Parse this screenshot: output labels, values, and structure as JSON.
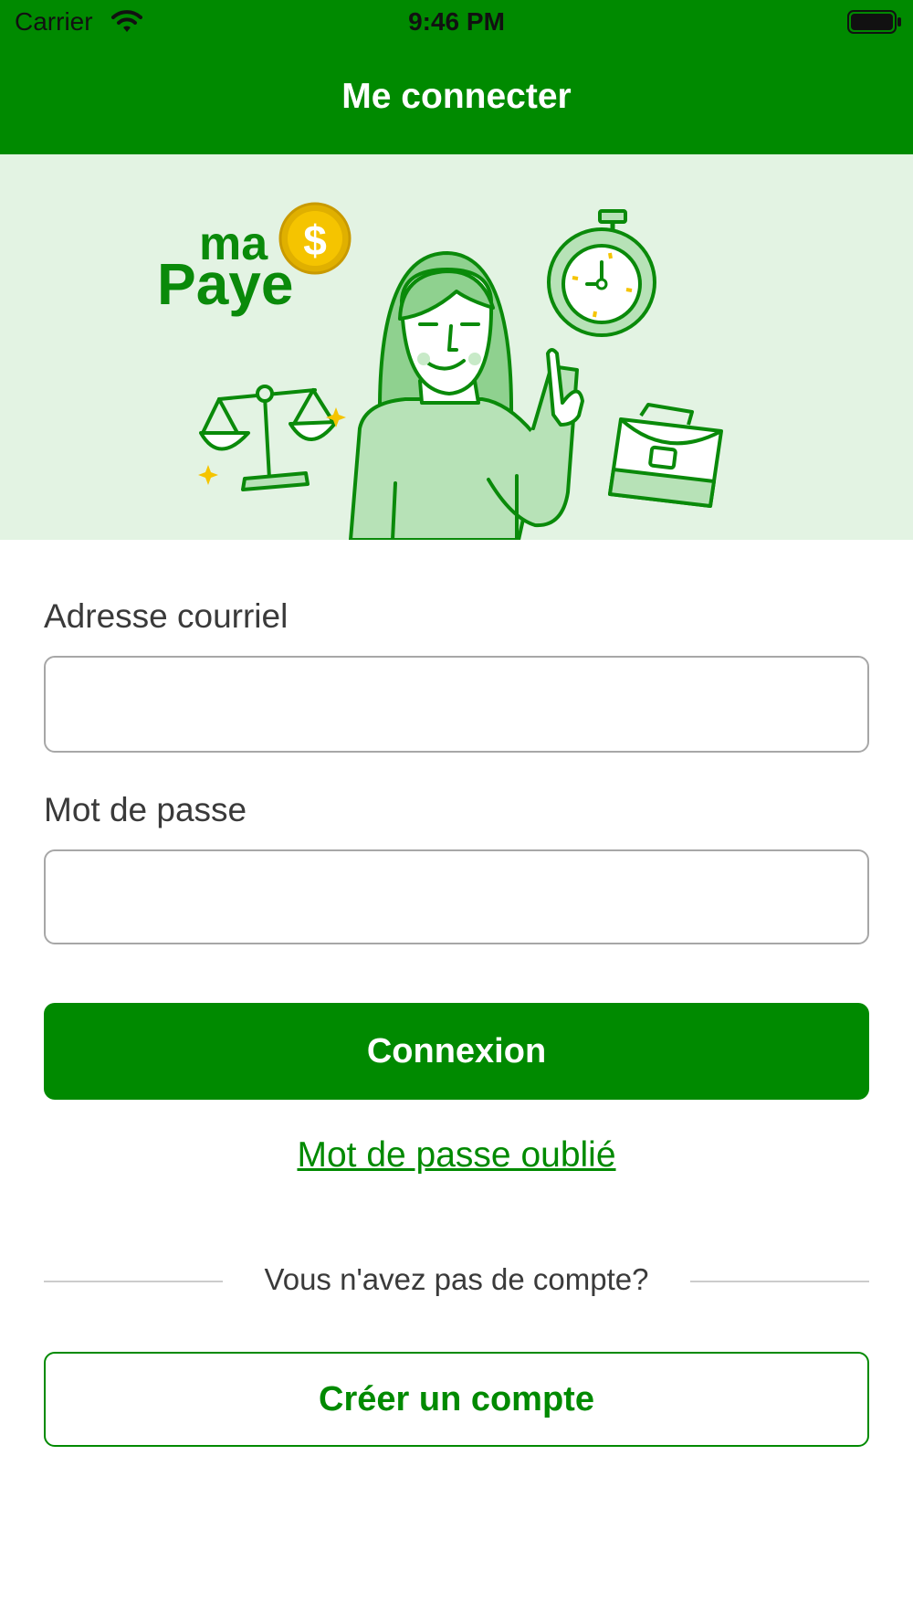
{
  "status_bar": {
    "carrier": "Carrier",
    "time": "9:46 PM"
  },
  "header": {
    "title": "Me connecter"
  },
  "hero": {
    "logo_line1": "ma",
    "logo_line2": "Paye",
    "coin_symbol": "$"
  },
  "form": {
    "email_label": "Adresse courriel",
    "email_value": "",
    "password_label": "Mot de passe",
    "password_value": "",
    "login_button": "Connexion",
    "forgot_link": "Mot de passe oublié"
  },
  "signup": {
    "prompt": "Vous n'avez pas de compte?",
    "create_button": "Créer un compte"
  },
  "colors": {
    "brand_green": "#008a00",
    "hero_bg": "#e3f3e3"
  }
}
